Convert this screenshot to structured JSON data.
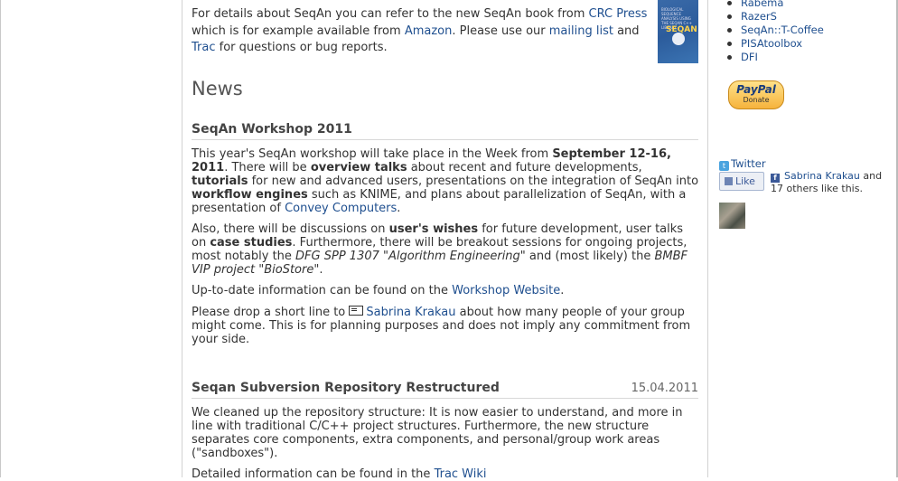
{
  "intro": {
    "t1": "For details about SeqAn you can refer to the new SeqAn book from ",
    "crc_press_link": "CRC Press",
    "t2": " which is for example available from ",
    "amazon_link": "Amazon",
    "t3": ". Please use our ",
    "mailing_list_link": "mailing list",
    "t4": " and ",
    "trac_link": "Trac",
    "t5": " for questions or bug reports."
  },
  "book_cover": {
    "title": "BIOLOGICAL SEQUENCE ANALYSIS USING THE SEQAN C++ LIBRARY",
    "logo": "SEQAN"
  },
  "news_heading": "News",
  "workshop": {
    "title": "SeqAn Workshop 2011",
    "p1": {
      "a": "This year's SeqAn workshop will take place in the Week from ",
      "b": "September 12-16, 2011",
      "c": ". There will be ",
      "d": "overview talks",
      "e": " about recent and future developments, ",
      "f": "tutorials",
      "g": " for new and advanced users, presentations on the integration of SeqAn into ",
      "h": "workflow engines",
      "i": " such as KNIME, and plans about parallelization of SeqAn, with a presentation of ",
      "link": "Convey Computers",
      "j": "."
    },
    "p2": {
      "a": "Also, there will be discussions on ",
      "b": "user's wishes",
      "c": " for future development, user talks on ",
      "d": "case studies",
      "e": ". Furthermore, there will be breakout sessions for ongoing projects, most notably the ",
      "f": "DFG SPP 1307 \"Algorithm Engineering\"",
      "g": " and (most likely) the ",
      "h": "BMBF VIP project \"BioStore\"",
      "i": "."
    },
    "p3": {
      "a": "Up-to-date information can be found on the ",
      "link": "Workshop Website",
      "b": "."
    },
    "p4": {
      "a": "Please drop a short line to ",
      "link": "Sabrina Krakau",
      "b": " about how many people of your group might come. This is for planning purposes and does not imply any commitment from your side."
    }
  },
  "svn": {
    "title": "Seqan Subversion Repository Restructured",
    "date": "15.04.2011",
    "p1": "We cleaned up the repository structure: It is now easier to understand, and more in line with traditional C/C++ project structures. Furthermore, the new structure separates core components, extra components, and personal/group work areas (\"sandboxes\").",
    "p2_a": "Detailed information can be found in the ",
    "p2_link": "Trac Wiki"
  },
  "sidebar": {
    "links": [
      "Rabema",
      "RazerS",
      "SeqAn::T-Coffee",
      "PISAtoolbox",
      "DFI"
    ],
    "paypal_logo": "PayPal",
    "paypal_label": "Donate",
    "twitter_icon_letter": "t",
    "twitter_label": "Twitter",
    "like_label": "Like",
    "fb_icon_letter": "f",
    "fb_name": "Sabrina Krakau",
    "fb_text": " and 17 others like this."
  }
}
